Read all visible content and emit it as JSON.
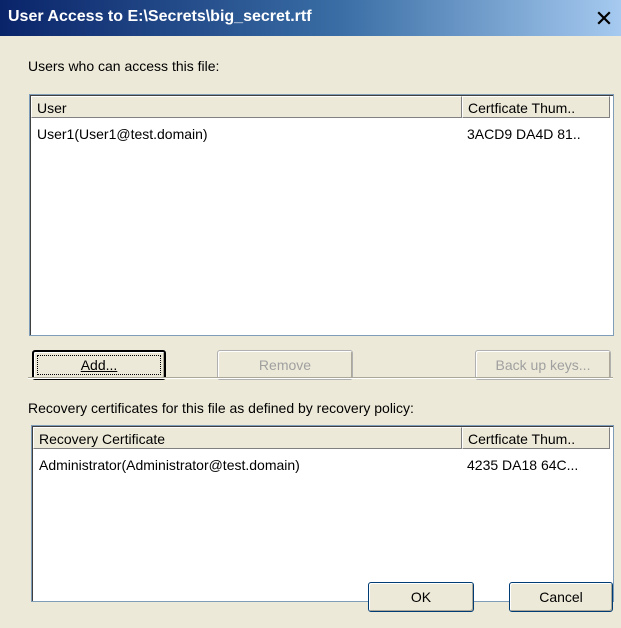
{
  "window": {
    "title": "User Access to E:\\Secrets\\big_secret.rtf",
    "close_glyph": "×"
  },
  "users_section": {
    "label": "Users who can access this file:",
    "columns": [
      "User",
      "Certficate Thum.."
    ],
    "rows": [
      {
        "user": "User1(User1@test.domain)",
        "thumbprint": "3ACD9 DA4D 81.."
      }
    ]
  },
  "buttons": {
    "add": "Add...",
    "remove": "Remove",
    "backup_keys": "Back up keys...",
    "ok": "OK",
    "cancel": "Cancel"
  },
  "recovery_section": {
    "label": "Recovery certificates for this file as defined by recovery policy:",
    "columns": [
      "Recovery Certificate",
      "Certficate Thum.."
    ],
    "rows": [
      {
        "certificate": "Administrator(Administrator@test.domain)",
        "thumbprint": "4235 DA18 64C..."
      }
    ]
  }
}
